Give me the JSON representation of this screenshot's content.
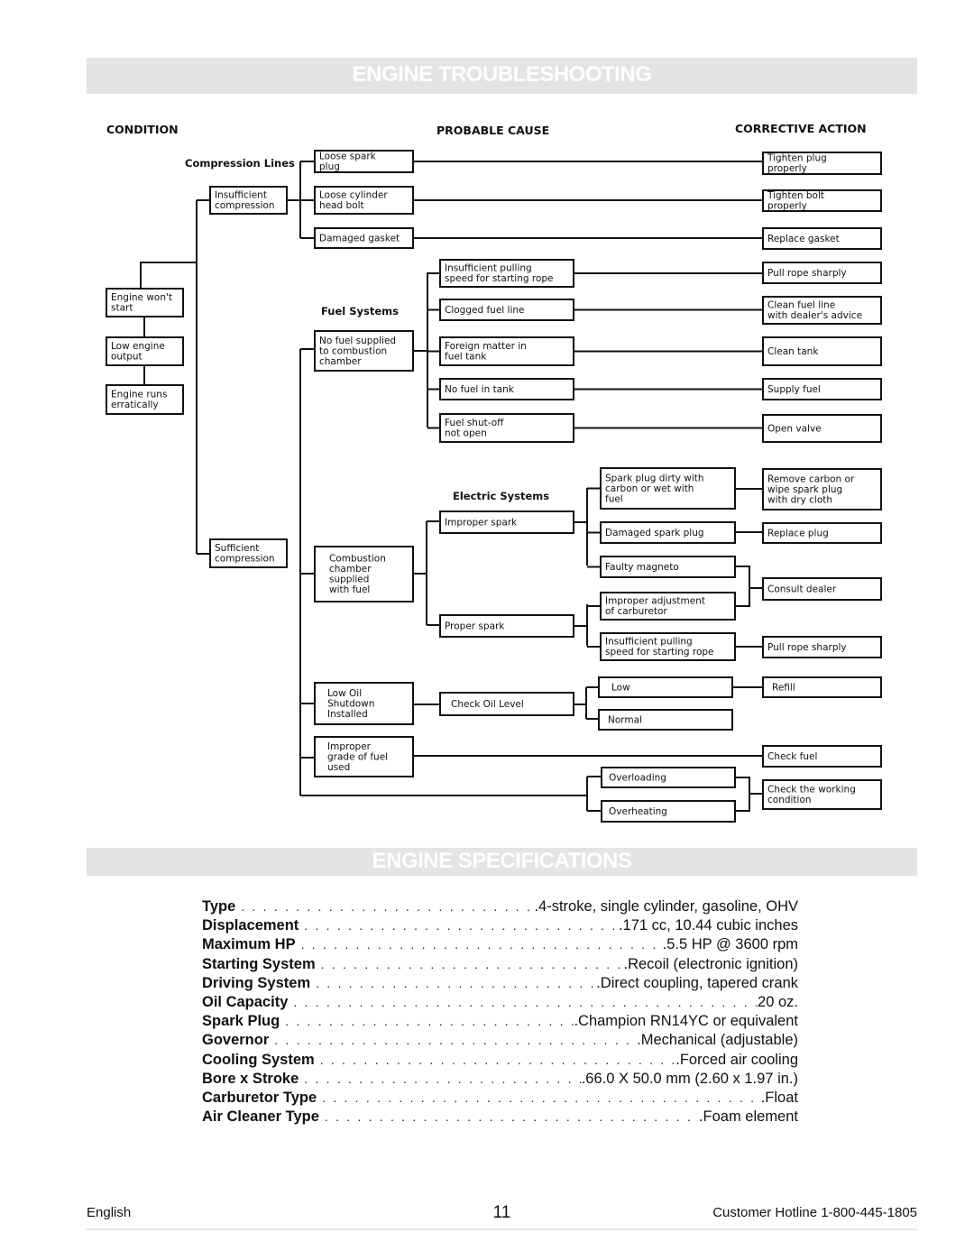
{
  "troubleshooting": {
    "title": "ENGINE TROUBLESHOOTING",
    "headers": {
      "condition": "CONDITION",
      "cause": "PROBABLE CAUSE",
      "action": "CORRECTIVE ACTION"
    },
    "groups": {
      "compression": "Compression Lines",
      "fuel": "Fuel Systems",
      "electric": "Electric Systems"
    },
    "conditions": [
      "Engine won't start",
      "Low engine output",
      "Engine runs erratically"
    ],
    "compression_state": {
      "insufficient": "Insufficient compression",
      "sufficient": "Sufficient compression"
    },
    "compression_causes": [
      {
        "cause": "Loose spark plug",
        "action": "Tighten plug properly"
      },
      {
        "cause": "Loose cylinder head bolt",
        "action": "Tighten bolt properly"
      },
      {
        "cause": "Damaged gasket",
        "action": "Replace gasket"
      }
    ],
    "fuel_root": "No fuel supplied to combustion chamber",
    "fuel_causes": [
      {
        "cause": "Insufficient pulling speed for starting rope",
        "action": "Pull rope sharply"
      },
      {
        "cause": "Clogged fuel line",
        "action": "Clean fuel line with dealer's advice"
      },
      {
        "cause": "Foreign matter in fuel tank",
        "action": "Clean tank"
      },
      {
        "cause": "No fuel in tank",
        "action": "Supply fuel"
      },
      {
        "cause": "Fuel shut-off not open",
        "action": "Open valve"
      }
    ],
    "combustion_root": "Combustion chamber supplied with fuel",
    "spark": {
      "improper": "Improper spark",
      "proper": "Proper spark"
    },
    "electric_causes": [
      {
        "cause": "Spark plug dirty with carbon or wet with fuel",
        "action": "Remove carbon or wipe spark plug with dry cloth"
      },
      {
        "cause": "Damaged spark plug",
        "action": "Replace plug"
      },
      {
        "cause": "Faulty magneto",
        "action": "Consult dealer"
      },
      {
        "cause": "Improper adjustment of carburetor",
        "action": "Consult dealer"
      },
      {
        "cause": "Insufficient pulling speed for starting rope",
        "action": "Pull rope sharply"
      }
    ],
    "oil": {
      "root": "Low Oil Shutdown Installed",
      "check": "Check Oil Level",
      "low": "Low",
      "normal": "Normal",
      "low_action": "Refill"
    },
    "fuel_grade": {
      "cause": "Improper grade of fuel used",
      "action": "Check fuel"
    },
    "load": {
      "overloading": "Overloading",
      "overheating": "Overheating",
      "action": "Check the working condition"
    }
  },
  "specifications": {
    "title": "ENGINE SPECIFICATIONS",
    "rows": [
      {
        "label": "Type",
        "value": ".4-stroke, single cylinder, gasoline, OHV"
      },
      {
        "label": "Displacement",
        "value": ".171 cc, 10.44 cubic inches"
      },
      {
        "label": "Maximum HP",
        "value": ".5.5 HP @ 3600 rpm"
      },
      {
        "label": "Starting System",
        "value": ".Recoil (electronic ignition)"
      },
      {
        "label": "Driving System",
        "value": ".Direct coupling, tapered crank"
      },
      {
        "label": "Oil Capacity",
        "value": " 20 oz."
      },
      {
        "label": "Spark Plug",
        "value": ".Champion RN14YC or equivalent"
      },
      {
        "label": "Governor",
        "value": ".Mechanical (adjustable)"
      },
      {
        "label": "Cooling System",
        "value": ".Forced air cooling"
      },
      {
        "label": "Bore x Stroke",
        "value": ".66.0 X 50.0 mm (2.60 x 1.97 in.)"
      },
      {
        "label": "Carburetor Type",
        "value": ".Float"
      },
      {
        "label": "Air Cleaner Type",
        "value": ".Foam element"
      }
    ]
  },
  "footer": {
    "language": "English",
    "page_number": "11",
    "hotline": "Customer Hotline 1-800-445-1805"
  }
}
